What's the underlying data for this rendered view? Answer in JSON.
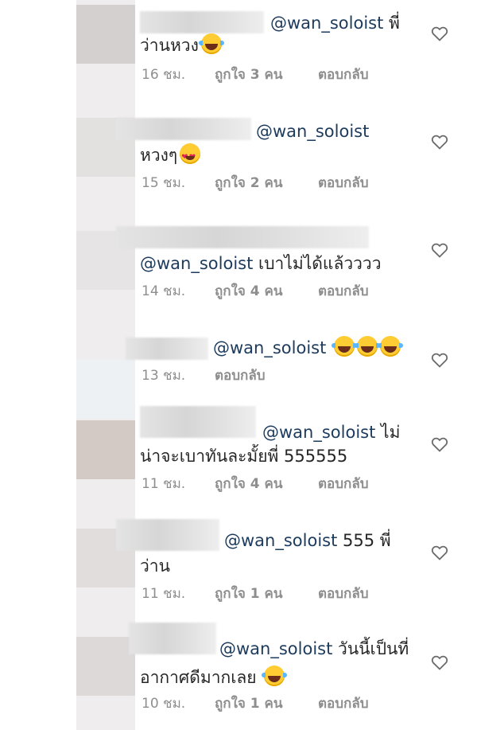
{
  "comments": [
    {
      "line1": "พี่",
      "line2": "ว่านหวง",
      "time": "16 ชม.",
      "likes": "ถูกใจ 3 คน",
      "reply": "ตอบกลับ"
    },
    {
      "line1": "",
      "line2": "หวงๆ",
      "time": "15 ชม.",
      "likes": "ถูกใจ 2 คน",
      "reply": "ตอบกลับ"
    },
    {
      "line1": "เบาไม่ได้แล้วววว",
      "time": "14 ชม.",
      "likes": "ถูกใจ 4 คน",
      "reply": "ตอบกลับ"
    },
    {
      "line1": "",
      "time": "13 ชม.",
      "likes": "",
      "reply": "ตอบกลับ"
    },
    {
      "line1": "ไม่",
      "line2": "น่าจะเบาทันละมั้ยพี่ 555555",
      "time": "11 ชม.",
      "likes": "ถูกใจ 4 คน",
      "reply": "ตอบกลับ"
    },
    {
      "line1": "555 พี่",
      "line2": "ว่าน",
      "time": "11 ชม.",
      "likes": "ถูกใจ 1 คน",
      "reply": "ตอบกลับ"
    },
    {
      "line1": "วันนี้เป็นที่",
      "line2": "อากาศดีมากเลย",
      "time": "10 ชม.",
      "likes": "ถูกใจ 1 คน",
      "reply": "ตอบกลับ"
    }
  ],
  "mention": "@wan_soloist",
  "icons": {
    "like": "heart-outline-icon",
    "laugh": "tears-of-joy-emoji",
    "love": "heart-eyes-emoji"
  }
}
